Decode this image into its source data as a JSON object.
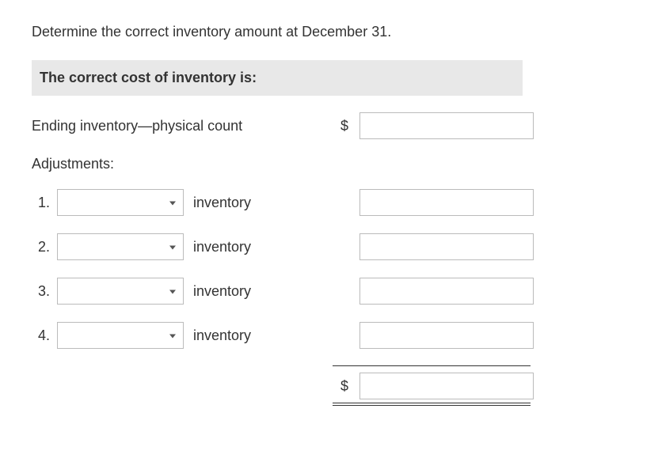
{
  "instruction": "Determine the correct inventory amount at December 31.",
  "header": "The correct cost of inventory is:",
  "ending_label": "Ending inventory—physical count",
  "adjustments_label": "Adjustments:",
  "currency": "$",
  "adjustments": [
    {
      "num": "1.",
      "after": "inventory"
    },
    {
      "num": "2.",
      "after": "inventory"
    },
    {
      "num": "3.",
      "after": "inventory"
    },
    {
      "num": "4.",
      "after": "inventory"
    }
  ]
}
